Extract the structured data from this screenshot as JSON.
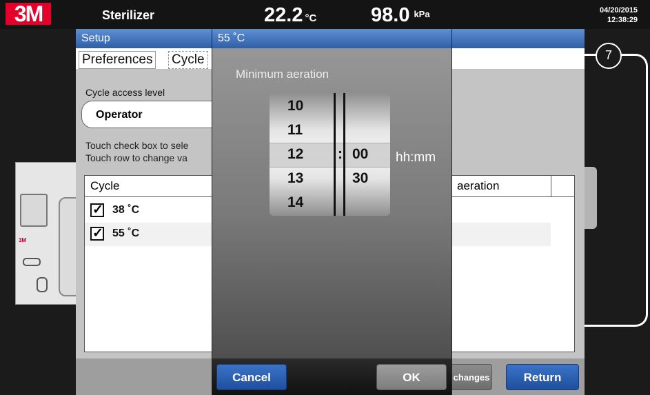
{
  "topbar": {
    "logo": "3M",
    "app_title": "Sterilizer",
    "temperature": "22.2",
    "temperature_unit": "°C",
    "pressure": "98.0",
    "pressure_unit": "kPa",
    "date": "04/20/2015",
    "time": "12:38:29"
  },
  "device": {
    "brand": "3M"
  },
  "callout": {
    "number": "7"
  },
  "setup": {
    "title": "Setup",
    "tabs": [
      {
        "label": "Preferences"
      },
      {
        "label": "Cycle"
      }
    ],
    "access_level_label": "Cycle access level",
    "access_level_value": "Operator",
    "hint_line1": "Touch check box to sele",
    "hint_line2": "Touch row to change va",
    "table": {
      "col_cycle": "Cycle",
      "col_aeration": "aeration",
      "rows": [
        {
          "label": "38 ˚C",
          "checked": true
        },
        {
          "label": "55 ˚C",
          "checked": true
        }
      ],
      "check_mark": "✓"
    },
    "buttons": {
      "changes": "changes",
      "return": "Return"
    }
  },
  "modal": {
    "title": "55 ˚C",
    "label": "Minimum aeration",
    "hours": [
      "10",
      "11",
      "12",
      "13",
      "14"
    ],
    "minutes": [
      "00",
      "30"
    ],
    "separator": ":",
    "unit": "hh:mm",
    "cancel_label": "Cancel",
    "ok_label": "OK"
  }
}
